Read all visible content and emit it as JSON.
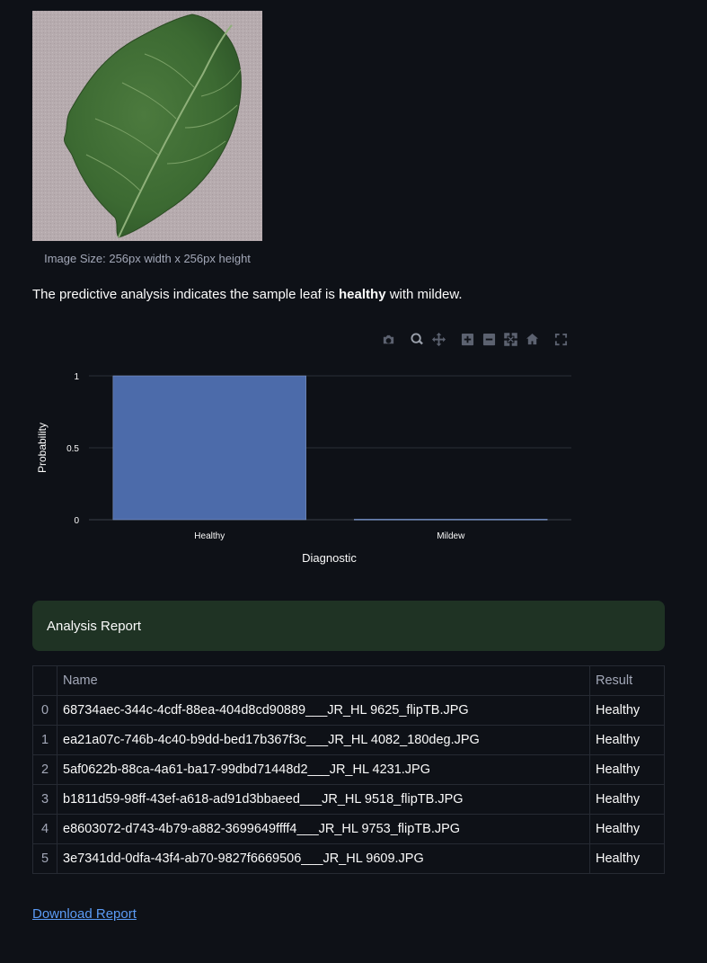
{
  "image": {
    "caption": "Image Size: 256px width x 256px height"
  },
  "result": {
    "prefix": "The predictive analysis indicates the sample leaf is ",
    "label": "healthy",
    "suffix": " with mildew."
  },
  "modebar": {
    "icons": [
      "camera-icon",
      "zoom-icon",
      "pan-icon",
      "zoom-in-icon",
      "zoom-out-icon",
      "autoscale-icon",
      "reset-axes-icon",
      "fullscreen-icon"
    ]
  },
  "chart_data": {
    "type": "bar",
    "categories": [
      "Healthy",
      "Mildew"
    ],
    "values": [
      1,
      0.004
    ],
    "xlabel": "Diagnostic",
    "ylabel": "Probability",
    "ylim": [
      0,
      1
    ],
    "yticks": [
      "0",
      "0.5",
      "1"
    ],
    "bar_color": "#4c6baa",
    "grid": true
  },
  "report": {
    "title": "Analysis Report",
    "columns": [
      "",
      "Name",
      "Result"
    ],
    "rows": [
      {
        "index": "0",
        "name": "68734aec-344c-4cdf-88ea-404d8cd90889___JR_HL 9625_flipTB.JPG",
        "result": "Healthy"
      },
      {
        "index": "1",
        "name": "ea21a07c-746b-4c40-b9dd-bed17b367f3c___JR_HL 4082_180deg.JPG",
        "result": "Healthy"
      },
      {
        "index": "2",
        "name": "5af0622b-88ca-4a61-ba17-99dbd71448d2___JR_HL 4231.JPG",
        "result": "Healthy"
      },
      {
        "index": "3",
        "name": "b1811d59-98ff-43ef-a618-ad91d3bbaeed___JR_HL 9518_flipTB.JPG",
        "result": "Healthy"
      },
      {
        "index": "4",
        "name": "e8603072-d743-4b79-a882-3699649ffff4___JR_HL 9753_flipTB.JPG",
        "result": "Healthy"
      },
      {
        "index": "5",
        "name": "3e7341dd-0dfa-43f4-ab70-9827f6669506___JR_HL 9609.JPG",
        "result": "Healthy"
      }
    ]
  },
  "download": {
    "label": "Download Report"
  }
}
